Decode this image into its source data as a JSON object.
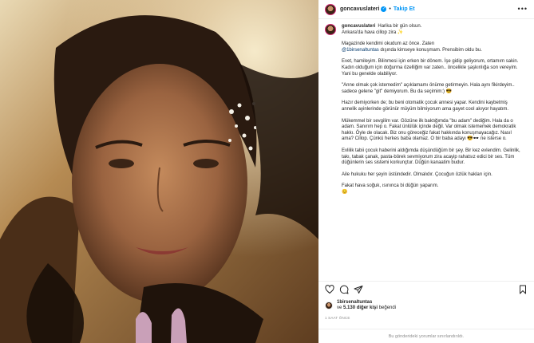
{
  "post": {
    "username": "goncavuslateri",
    "follow_label": "Takip Et",
    "more_icon": "•••",
    "verified_glyph": "✓",
    "dot": "•"
  },
  "caption": {
    "username": "goncavuslateri",
    "paragraphs": [
      "Harika bir gün olsun.\nAnkara'da hava cillop zira ✨",
      "Magazinde kendimi okudum az önce. Zaten",
      "Evet, hamileyim. Bilinmesi için erken bir dönem. İşe gidip geliyorum, ortamım sakin.\nKadın olduğum için doğurma özelliğim var zaten.. öncelikle şaşkınlığa son vereyim. Yani bu genelde olabiliyor.",
      "\"Anne olmak çok istemedim\" açıklamamı önüme getirmeyin. Hala aynı fikirdeyim.. sadece gelene \"git\" demiyorum. Bu da seçimim:) 😎",
      "Hazır demiyorken de; bu beni otomatik çocuk annesi yapar. Kendini kaybetmiş annelik ayinlerinde görünür müyüm bilmiyorum ama gayet cool akıyor hayatım.",
      "Mükemmel bir sevgilim var. Gözüne ilk baktığımda \"bu adam\" dediğim. Hala da o adam. Sanırım hep o. Fakat ünlülük içinde değil. Var olmak istememek demokratik hakkı. Öyle de olacak. Biz onu göreceğiz fakat hakkında konuşmayacağız. Nasıl ama? Cillop. Çünkü herkes baba olamaz. O bir baba adayı 😎🕶️ ne isterse o.",
      "Evlilik tabii çocuk haberini aldığımda düşündüğüm bir şey. Bir kez evlendim. Gelinlik, takı, tabak çanak, pasta-börek sevmiyorum zira acayip rahatsız edici bir ses. Tüm düğünlerin ses sistemi korkunçtur. Düğün kanaatim budur.",
      "Aile hukuku her şeyin üstündedir. Olmalıdır. Çocuğun özlük hakları için.",
      "Fakat hava soğuk, ısınınca bi düğün yaparım.\n😊"
    ],
    "mention": "@1birsenaltuntas",
    "mention_after": " dışında kimseye konuşmam. Prensibim oldu bu."
  },
  "likes": {
    "user": "1birsenaltuntas",
    "prefix": "ve ",
    "count_text": "5.130 diğer kişi",
    "suffix": " beğendi"
  },
  "time": "1 SAAT ÖNCE",
  "footer": "Bu gönderideki yorumlar sınırlandırıldı.",
  "icons": [
    "heart-icon",
    "comment-icon",
    "share-icon",
    "bookmark-icon",
    "more-icon",
    "verified-icon"
  ],
  "colors": {
    "accent": "#0095f6",
    "text": "#262626",
    "muted": "#8e8e8e",
    "mention": "#00376b",
    "border": "#efefef"
  }
}
